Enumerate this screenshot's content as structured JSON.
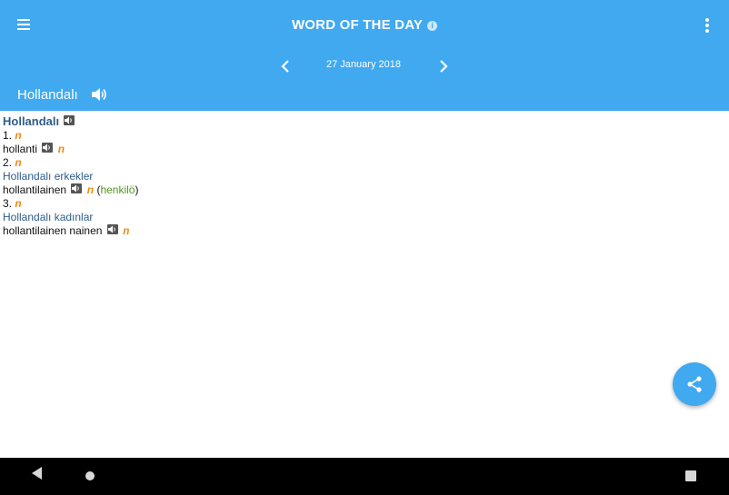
{
  "app_bar": {
    "title": "WORD OF THE DAY",
    "menu_icon": "hamburger-menu-icon",
    "info_icon": "info-icon",
    "info_glyph": "i",
    "more_icon": "more-vert-icon",
    "color": "#40a9f0"
  },
  "date_nav": {
    "date": "27 January 2018",
    "prev_icon": "chevron-left-icon",
    "next_icon": "chevron-right-icon"
  },
  "headword_bar": {
    "word": "Hollandalı",
    "speaker_icon": "volume-icon"
  },
  "entry": {
    "headword": "Hollandalı",
    "senses": [
      {
        "number": "1.",
        "pos": "n",
        "source": "",
        "translation": "hollanti",
        "translation_pos": "n",
        "gloss": ""
      },
      {
        "number": "2.",
        "pos": "n",
        "source": "Hollandalı erkekler",
        "translation": "hollantilainen",
        "translation_pos": "n",
        "gloss_open": "(",
        "gloss": "henkilö",
        "gloss_close": ")"
      },
      {
        "number": "3.",
        "pos": "n",
        "source": "Hollandalı kadınlar",
        "translation": "hollantilainen nainen",
        "translation_pos": "n",
        "gloss": ""
      }
    ]
  },
  "fab": {
    "icon": "share-icon"
  },
  "nav_bar": {
    "back_icon": "back-triangle-icon",
    "home_icon": "home-circle-icon",
    "recents_icon": "recents-square-icon"
  }
}
